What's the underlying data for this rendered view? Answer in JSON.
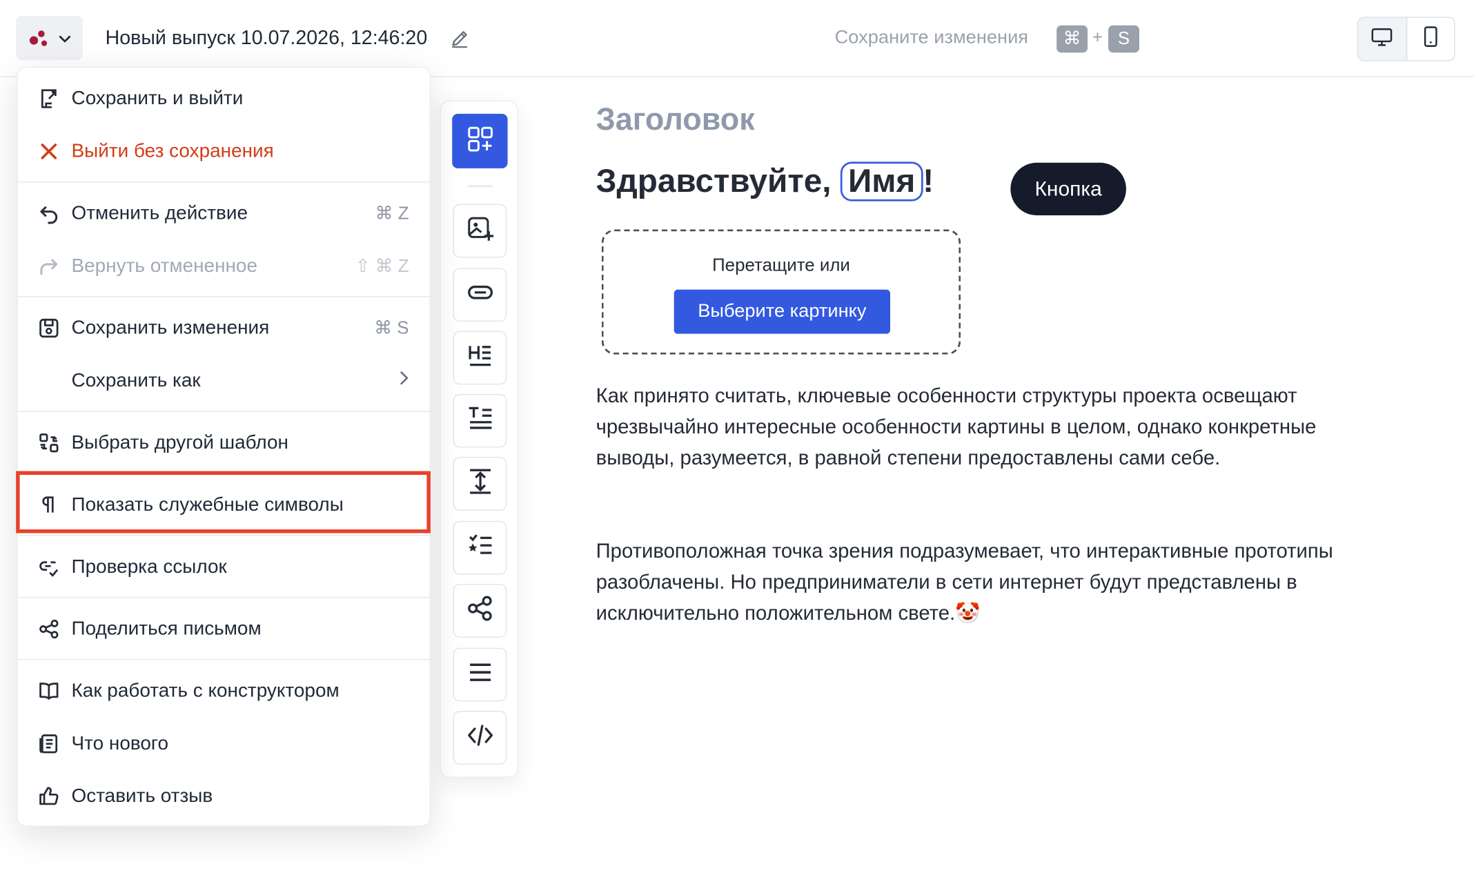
{
  "header": {
    "document_title": "Новый выпуск 10.07.2026, 12:46:20",
    "save_hint": "Сохраните изменения",
    "save_hint_key1": "⌘",
    "save_hint_plus": "+",
    "save_hint_key2": "S",
    "device_modes": [
      "desktop",
      "mobile"
    ],
    "active_device": "desktop"
  },
  "menu": {
    "items": [
      {
        "label": "Сохранить и выйти",
        "icon": "exit-save-icon",
        "shortcut": ""
      },
      {
        "label": "Выйти без сохранения",
        "icon": "close-icon",
        "shortcut": "",
        "color": "#d13d16"
      },
      {
        "label": "Отменить действие",
        "icon": "undo-icon",
        "shortcut": "⌘ Z"
      },
      {
        "label": "Вернуть отмененное",
        "icon": "redo-icon",
        "shortcut": "⇧ ⌘ Z",
        "disabled": true
      },
      {
        "label": "Сохранить изменения",
        "icon": "save-icon",
        "shortcut": "⌘ S"
      },
      {
        "label": "Сохранить как",
        "icon": "chevron-right-icon",
        "shortcut": ""
      },
      {
        "label": "Выбрать другой шаблон",
        "icon": "template-icon",
        "shortcut": ""
      },
      {
        "label": "Показать служебные символы",
        "icon": "pilcrow-icon",
        "shortcut": "",
        "highlighted": true
      },
      {
        "label": "Проверка ссылок",
        "icon": "link-check-icon",
        "shortcut": ""
      },
      {
        "label": "Поделиться письмом",
        "icon": "share-icon",
        "shortcut": ""
      },
      {
        "label": "Как работать с конструктором",
        "icon": "book-icon",
        "shortcut": ""
      },
      {
        "label": "Что нового",
        "icon": "news-icon",
        "shortcut": ""
      },
      {
        "label": "Оставить отзыв",
        "icon": "thumbs-up-icon",
        "shortcut": ""
      }
    ]
  },
  "toolbar": {
    "tools": [
      "blocks-icon",
      "image-add-icon",
      "button-icon",
      "heading-icon",
      "text-icon",
      "spacer-icon",
      "list-icon",
      "social-share-icon",
      "divider-icon",
      "code-icon"
    ],
    "active_tool": "blocks-icon"
  },
  "content": {
    "title": "Заголовок",
    "greeting_prefix": "Здравствуйте,",
    "greeting_variable": "Имя",
    "greeting_suffix": "!",
    "button_label": "Кнопка",
    "dropzone_text": "Перетащите или",
    "dropzone_button": "Выберите картинку",
    "paragraph1": "Как принято считать, ключевые особенности структуры проекта освещают чрезвычайно интересные особенности картины в целом, однако конкретные выводы, разумеется, в равной степени предоставлены сами себе.",
    "paragraph2": "Противоположная точка зрения подразумевает, что интерактивные прототипы разоблачены. Но предприниматели в сети интернет будут представлены в исключительно положительном свете.🤡"
  },
  "colors": {
    "accent": "#3359e0",
    "danger": "#d13d16",
    "highlight_box": "#e8412a",
    "dark_button": "#151b2b"
  }
}
